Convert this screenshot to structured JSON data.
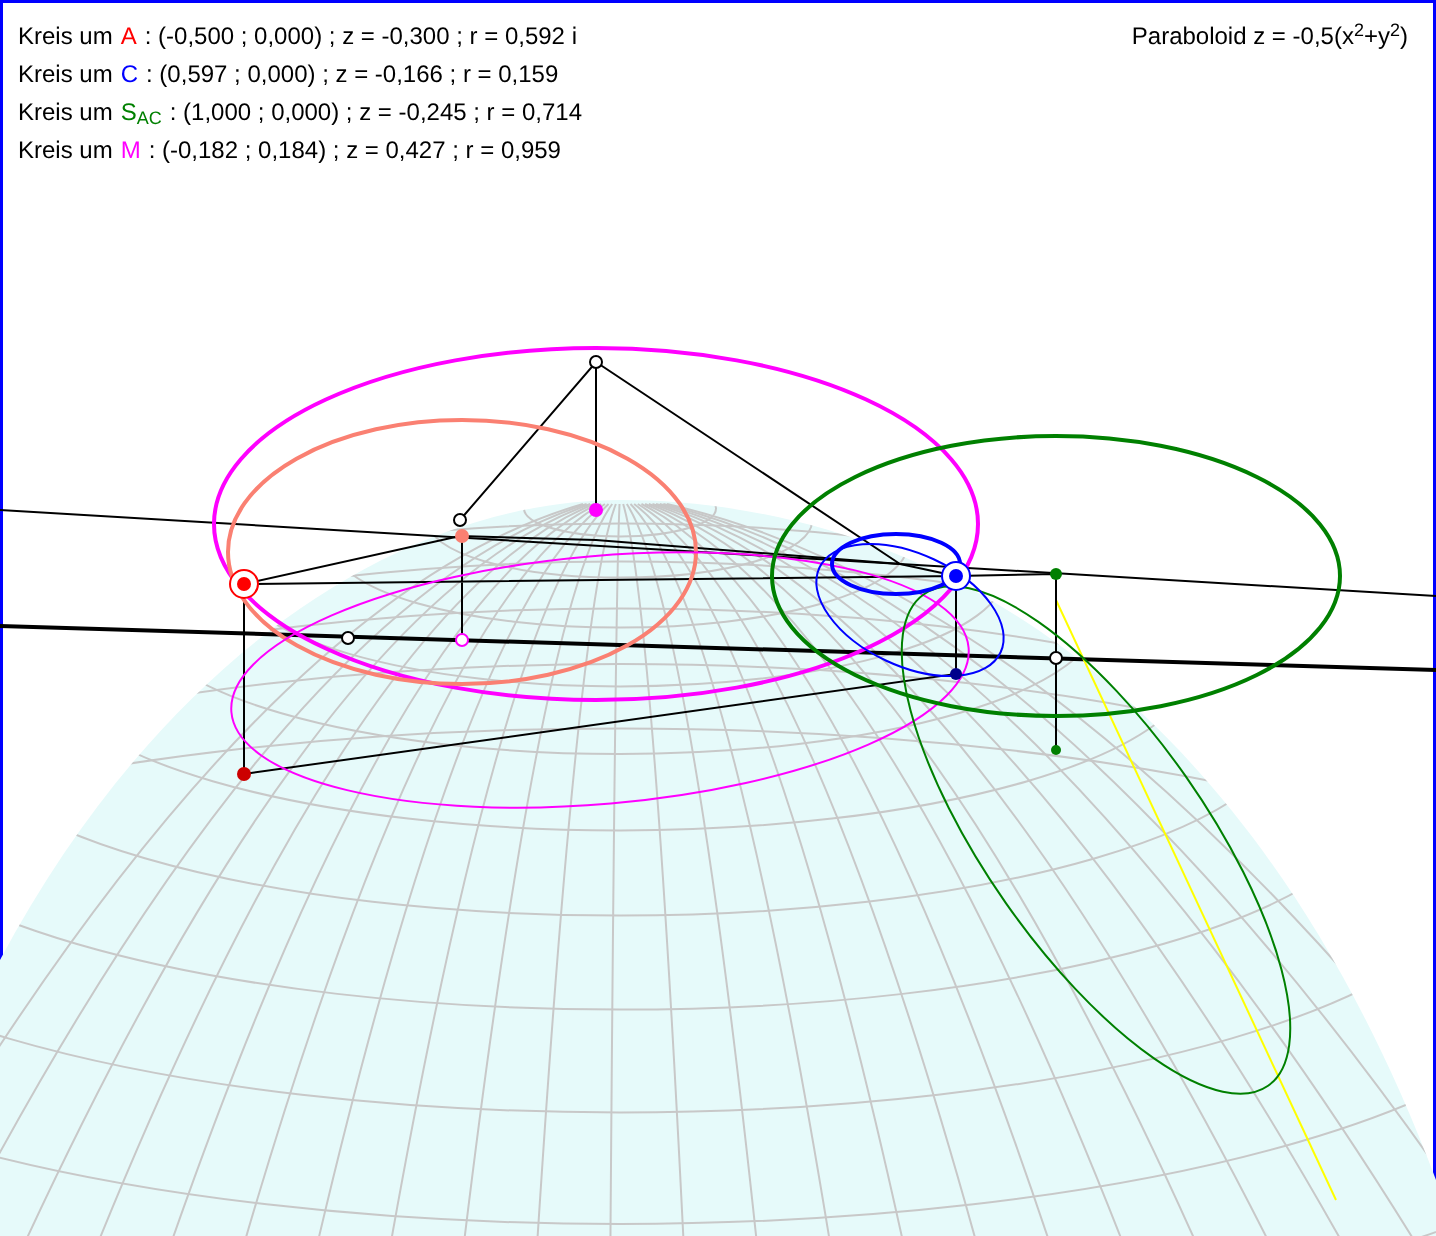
{
  "circles": [
    {
      "prefix": "Kreis um",
      "point": "A",
      "color": "#ff0000",
      "details": ": (-0,500 ; 0,000) ; z = -0,300 ; r = 0,592 i"
    },
    {
      "prefix": "Kreis um",
      "point": "C",
      "color": "#0000ff",
      "details": ": (0,597 ; 0,000) ; z = -0,166 ; r = 0,159"
    },
    {
      "prefix": "Kreis um",
      "point": "S$_{AC}$",
      "color": "#008000",
      "details": ": (1,000 ; 0,000) ; z = -0,245 ; r = 0,714"
    },
    {
      "prefix": "Kreis um",
      "point": "M",
      "color": "#ff00ff",
      "details": ": (-0,182 ; 0,184) ; z = 0,427 ; r = 0,959"
    }
  ],
  "surface_label": "Paraboloid z = -0,5(x$^{2}$+y$^{2}$)"
}
